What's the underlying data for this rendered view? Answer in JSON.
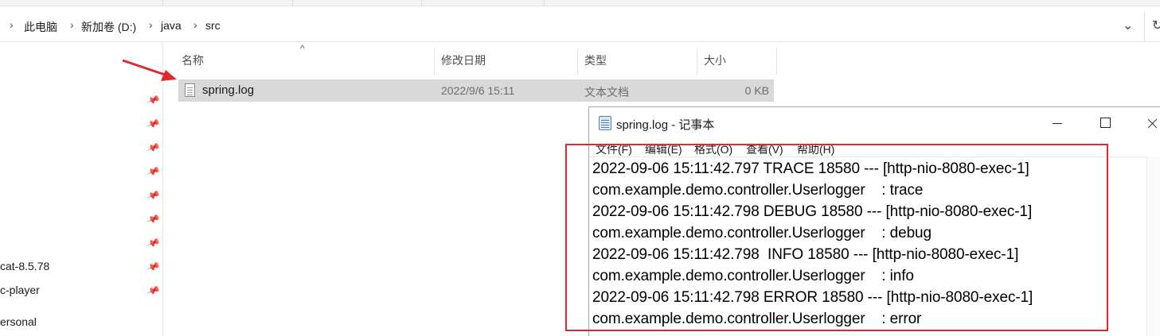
{
  "breadcrumb": {
    "items": [
      "此电脑",
      "新加卷 (D:)",
      "java",
      "src"
    ],
    "separator": "›"
  },
  "file_list": {
    "columns": [
      "名称",
      "修改日期",
      "类型",
      "大小"
    ],
    "rows": [
      {
        "name": "spring.log",
        "modified": "2022/9/6 15:11",
        "type": "文本文档",
        "size": "0 KB",
        "selected": true
      }
    ]
  },
  "nav_pane": {
    "items": [
      "cat-8.5.78",
      "c-player",
      "ersonal"
    ]
  },
  "notepad": {
    "title": "spring.log - 记事本",
    "menu": [
      "文件(F)",
      "编辑(E)",
      "格式(O)",
      "查看(V)",
      "帮助(H)"
    ],
    "lines": [
      "2022-09-06 15:11:42.797 TRACE 18580 --- [http-nio-8080-exec-1]",
      "com.example.demo.controller.Userlogger    : trace",
      "2022-09-06 15:11:42.798 DEBUG 18580 --- [http-nio-8080-exec-1]",
      "com.example.demo.controller.Userlogger    : debug",
      "2022-09-06 15:11:42.798  INFO 18580 --- [http-nio-8080-exec-1]",
      "com.example.demo.controller.Userlogger    : info",
      "2022-09-06 15:11:42.798 ERROR 18580 --- [http-nio-8080-exec-1]",
      "com.example.demo.controller.Userlogger    : error"
    ]
  },
  "colors": {
    "selection": "#d9d9d9",
    "annotation_red": "#e0282e",
    "header_text": "#4d4d4d"
  },
  "icons": [
    "chevron-right-icon",
    "chevron-down-icon",
    "refresh-icon",
    "sort-up-icon",
    "pin-icon",
    "text-file-icon",
    "notepad-icon",
    "minimize-icon",
    "maximize-icon",
    "close-icon",
    "annotation-arrow-icon"
  ]
}
